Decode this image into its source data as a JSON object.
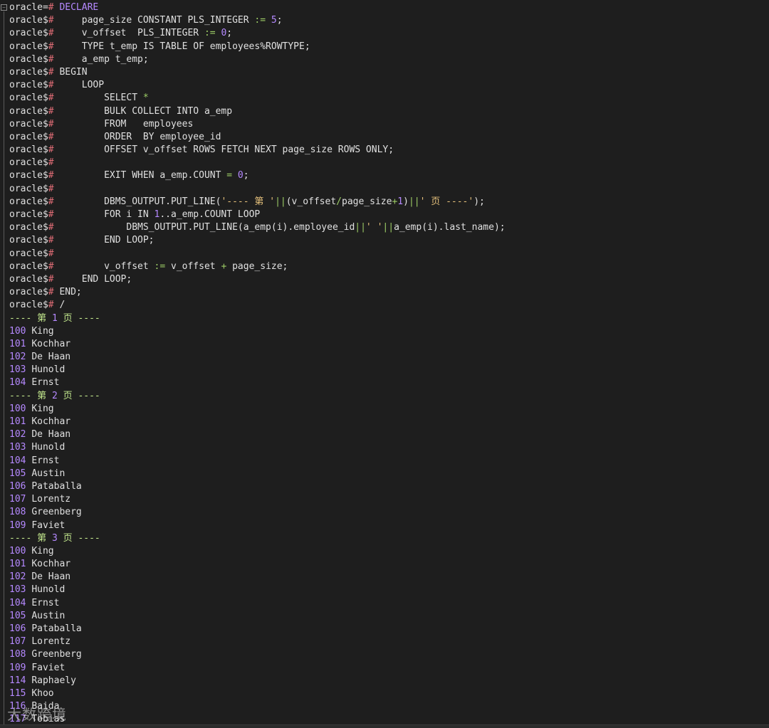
{
  "prompt": {
    "first": "oracle=",
    "cont": "oracle$",
    "hash": "#"
  },
  "code_lines": [
    {
      "first": true,
      "segments": [
        {
          "t": " ",
          "c": "kw"
        },
        {
          "t": "DECLARE",
          "c": "id"
        }
      ]
    },
    {
      "segments": [
        {
          "t": "     page_size CONSTANT PLS_INTEGER ",
          "c": "kw"
        },
        {
          "t": ":=",
          "c": "op"
        },
        {
          "t": " ",
          "c": "kw"
        },
        {
          "t": "5",
          "c": "num"
        },
        {
          "t": ";",
          "c": "kw"
        }
      ]
    },
    {
      "segments": [
        {
          "t": "     v_offset  PLS_INTEGER ",
          "c": "kw"
        },
        {
          "t": ":=",
          "c": "op"
        },
        {
          "t": " ",
          "c": "kw"
        },
        {
          "t": "0",
          "c": "num"
        },
        {
          "t": ";",
          "c": "kw"
        }
      ]
    },
    {
      "segments": [
        {
          "t": "     TYPE t_emp IS TABLE OF employees%ROWTYPE;",
          "c": "kw"
        }
      ]
    },
    {
      "segments": [
        {
          "t": "     a_emp t_emp;",
          "c": "kw"
        }
      ]
    },
    {
      "segments": [
        {
          "t": " BEGIN",
          "c": "kw"
        }
      ]
    },
    {
      "segments": [
        {
          "t": "     LOOP",
          "c": "kw"
        }
      ]
    },
    {
      "segments": [
        {
          "t": "         SELECT ",
          "c": "kw"
        },
        {
          "t": "*",
          "c": "op"
        }
      ]
    },
    {
      "segments": [
        {
          "t": "         BULK COLLECT INTO a_emp",
          "c": "kw"
        }
      ]
    },
    {
      "segments": [
        {
          "t": "         FROM   employees",
          "c": "kw"
        }
      ]
    },
    {
      "segments": [
        {
          "t": "         ORDER  BY employee_id",
          "c": "kw"
        }
      ]
    },
    {
      "segments": [
        {
          "t": "         OFFSET v_offset ROWS FETCH NEXT page_size ROWS ONLY;",
          "c": "kw"
        }
      ]
    },
    {
      "segments": [
        {
          "t": "",
          "c": "kw"
        }
      ]
    },
    {
      "segments": [
        {
          "t": "         EXIT WHEN a_emp.COUNT ",
          "c": "kw"
        },
        {
          "t": "=",
          "c": "op"
        },
        {
          "t": " ",
          "c": "kw"
        },
        {
          "t": "0",
          "c": "num"
        },
        {
          "t": ";",
          "c": "kw"
        }
      ]
    },
    {
      "segments": [
        {
          "t": "",
          "c": "kw"
        }
      ]
    },
    {
      "segments": [
        {
          "t": "         DBMS_OUTPUT.PUT_LINE(",
          "c": "kw"
        },
        {
          "t": "'---- 第 '",
          "c": "str"
        },
        {
          "t": "||",
          "c": "op"
        },
        {
          "t": "(v_offset",
          "c": "kw"
        },
        {
          "t": "/",
          "c": "op"
        },
        {
          "t": "page_size",
          "c": "kw"
        },
        {
          "t": "+",
          "c": "op"
        },
        {
          "t": "1",
          "c": "num"
        },
        {
          "t": ")",
          "c": "kw"
        },
        {
          "t": "||",
          "c": "op"
        },
        {
          "t": "' 页 ----'",
          "c": "str"
        },
        {
          "t": ");",
          "c": "kw"
        }
      ]
    },
    {
      "segments": [
        {
          "t": "         FOR i IN ",
          "c": "kw"
        },
        {
          "t": "1",
          "c": "num"
        },
        {
          "t": "..a_emp.COUNT LOOP",
          "c": "kw"
        }
      ]
    },
    {
      "segments": [
        {
          "t": "             DBMS_OUTPUT.PUT_LINE(a_emp(i).employee_id",
          "c": "kw"
        },
        {
          "t": "||",
          "c": "op"
        },
        {
          "t": "' '",
          "c": "str"
        },
        {
          "t": "||",
          "c": "op"
        },
        {
          "t": "a_emp(i).last_name);",
          "c": "kw"
        }
      ]
    },
    {
      "segments": [
        {
          "t": "         END LOOP;",
          "c": "kw"
        }
      ]
    },
    {
      "segments": [
        {
          "t": "",
          "c": "kw"
        }
      ]
    },
    {
      "segments": [
        {
          "t": "         v_offset ",
          "c": "kw"
        },
        {
          "t": ":=",
          "c": "op"
        },
        {
          "t": " v_offset ",
          "c": "kw"
        },
        {
          "t": "+",
          "c": "op"
        },
        {
          "t": " page_size;",
          "c": "kw"
        }
      ]
    },
    {
      "segments": [
        {
          "t": "     END LOOP;",
          "c": "kw"
        }
      ]
    },
    {
      "segments": [
        {
          "t": " END;",
          "c": "kw"
        }
      ]
    },
    {
      "segments": [
        {
          "t": " /",
          "c": "kw"
        }
      ]
    }
  ],
  "output": {
    "page_header_prefix": "---- 第 ",
    "page_header_suffix": " 页 ----",
    "pages": [
      {
        "page": "1",
        "rows": [
          {
            "id": "100",
            "name": "King"
          },
          {
            "id": "101",
            "name": "Kochhar"
          },
          {
            "id": "102",
            "name": "De Haan"
          },
          {
            "id": "103",
            "name": "Hunold"
          },
          {
            "id": "104",
            "name": "Ernst"
          }
        ]
      },
      {
        "page": "2",
        "rows": [
          {
            "id": "100",
            "name": "King"
          },
          {
            "id": "101",
            "name": "Kochhar"
          },
          {
            "id": "102",
            "name": "De Haan"
          },
          {
            "id": "103",
            "name": "Hunold"
          },
          {
            "id": "104",
            "name": "Ernst"
          },
          {
            "id": "105",
            "name": "Austin"
          },
          {
            "id": "106",
            "name": "Pataballa"
          },
          {
            "id": "107",
            "name": "Lorentz"
          },
          {
            "id": "108",
            "name": "Greenberg"
          },
          {
            "id": "109",
            "name": "Faviet"
          }
        ]
      },
      {
        "page": "3",
        "rows": [
          {
            "id": "100",
            "name": "King"
          },
          {
            "id": "101",
            "name": "Kochhar"
          },
          {
            "id": "102",
            "name": "De Haan"
          },
          {
            "id": "103",
            "name": "Hunold"
          },
          {
            "id": "104",
            "name": "Ernst"
          },
          {
            "id": "105",
            "name": "Austin"
          },
          {
            "id": "106",
            "name": "Pataballa"
          },
          {
            "id": "107",
            "name": "Lorentz"
          },
          {
            "id": "108",
            "name": "Greenberg"
          },
          {
            "id": "109",
            "name": "Faviet"
          },
          {
            "id": "114",
            "name": "Raphaely"
          },
          {
            "id": "115",
            "name": "Khoo"
          },
          {
            "id": "116",
            "name": "Baida"
          },
          {
            "id": "117",
            "name": "Tobias"
          }
        ]
      }
    ]
  },
  "watermark": "大数跨境",
  "icons": {
    "fold": "fold-collapse-icon"
  },
  "colors": {
    "background": "#1e1e1e",
    "text": "#e0e0e0",
    "hash": "#e06c75",
    "number": "#b589ff",
    "string": "#e5c07b",
    "operator": "#9ccc65"
  }
}
